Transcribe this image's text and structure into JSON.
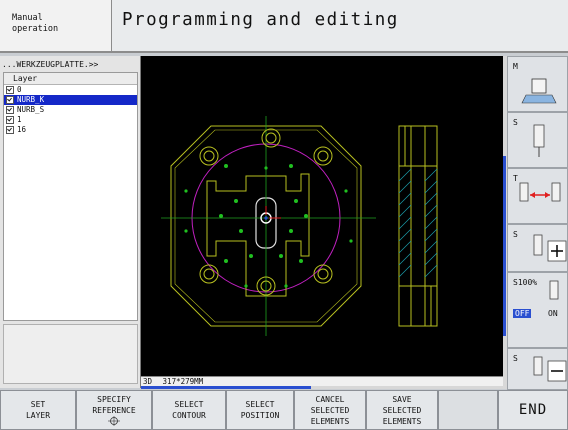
{
  "header": {
    "mode_label": "Manual\noperation",
    "title": "Programming and editing"
  },
  "layer_panel": {
    "path": "...WERKZEUGPLATTE.>>",
    "column_header": "Layer",
    "layers": [
      {
        "name": "0",
        "checked": true,
        "selected": false
      },
      {
        "name": "NURB_K",
        "checked": true,
        "selected": true
      },
      {
        "name": "NURB_S",
        "checked": true,
        "selected": false
      },
      {
        "name": "1",
        "checked": true,
        "selected": false
      },
      {
        "name": "16",
        "checked": true,
        "selected": false
      }
    ]
  },
  "status_bar": {
    "view_mode": "3D",
    "dimensions": "317*279MM"
  },
  "right_keys": [
    {
      "label": "M",
      "icon": "m-function-icon"
    },
    {
      "label": "S",
      "icon": "spindle-icon"
    },
    {
      "label": "T",
      "icon": "tool-change-icon"
    },
    {
      "label": "S",
      "icon": "spindle-speed-plus-icon"
    },
    {
      "label": "S100%",
      "state_off": "OFF",
      "state_on": "ON",
      "icon": "spindle-override-icon"
    },
    {
      "label": "S",
      "icon": "spindle-speed-minus-icon"
    }
  ],
  "bottom_keys": {
    "set_layer": "SET\nLAYER",
    "specify_reference": "SPECIFY\nREFERENCE",
    "select_contour": "SELECT\nCONTOUR",
    "select_position": "SELECT\nPOSITION",
    "cancel_selected": "CANCEL\nSELECTED\nELEMENTS",
    "save_selected": "SAVE\nSELECTED\nELEMENTS",
    "end": "END"
  },
  "colors": {
    "geometry": "#b8c020",
    "dots": "#20c020",
    "circle": "#c020c0",
    "axis": "#20a020",
    "selection": "#1428c8",
    "accent_blue": "#2a4fd0"
  }
}
